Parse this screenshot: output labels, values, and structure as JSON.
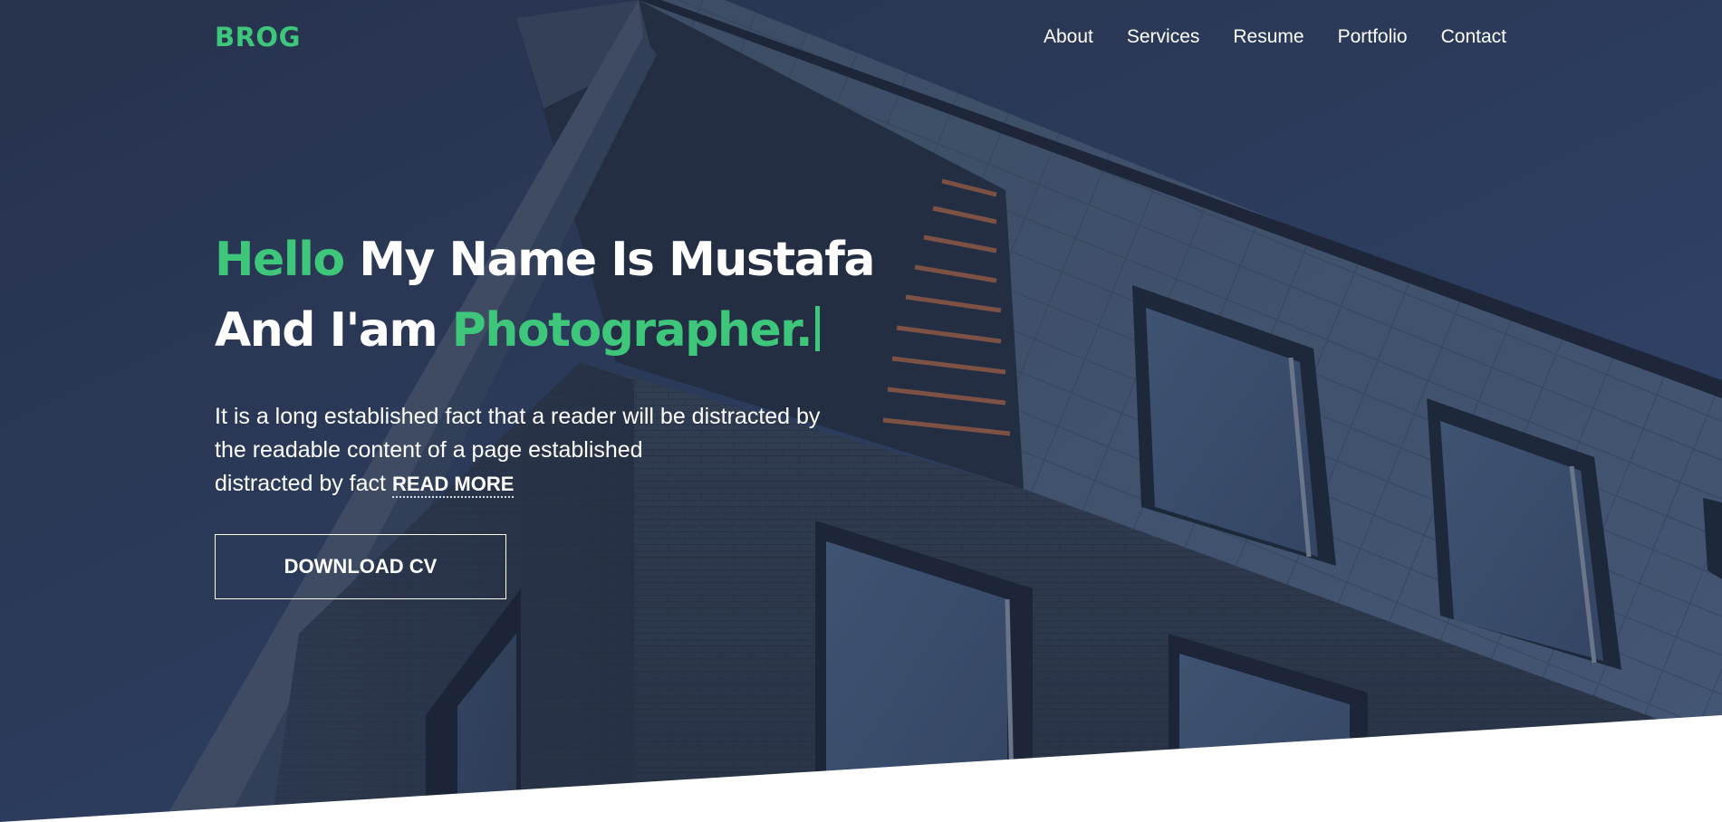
{
  "colors": {
    "accent": "#3ec67b",
    "text": "#ffffff",
    "overlay": "#2d3d5e"
  },
  "nav": {
    "logo": "BROG",
    "items": [
      "About",
      "Services",
      "Resume",
      "Portfolio",
      "Contact"
    ]
  },
  "hero": {
    "line1": {
      "accent": "Hello",
      "rest": "My Name Is Mustafa"
    },
    "line2": {
      "rest": "And I'am",
      "accent": "Photographer."
    },
    "intro_line1": "It is a long established fact that a reader will be distracted by",
    "intro_line2": "the readable content of a page established",
    "intro_line3": "distracted by fact",
    "read_more": "READ MORE",
    "cta_label": "DOWNLOAD CV"
  }
}
